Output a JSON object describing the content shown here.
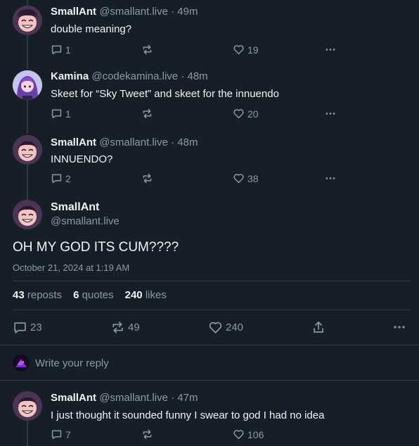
{
  "posts": [
    {
      "author_name": "SmallAnt",
      "author_handle": "@smallant.live",
      "separator": "·",
      "time": "49m",
      "text": "double meaning?",
      "reply_count": "1",
      "like_count": "19",
      "avatar": "smallant-avatar"
    },
    {
      "author_name": "Kamina",
      "author_handle": "@codekamina.live",
      "separator": "·",
      "time": "48m",
      "text": "Skeet for “Sky Tweet” and skeet for the innuendo",
      "reply_count": "1",
      "like_count": "20",
      "avatar": "kamina-avatar"
    },
    {
      "author_name": "SmallAnt",
      "author_handle": "@smallant.live",
      "separator": "·",
      "time": "48m",
      "text": "INNUENDO?",
      "reply_count": "2",
      "like_count": "38",
      "avatar": "smallant-avatar"
    }
  ],
  "main_post": {
    "author_name": "SmallAnt",
    "author_handle": "@smallant.live",
    "text": "OH MY GOD ITS CUM????",
    "date": "October 21, 2024 at 1:19 AM",
    "reposts_count": "43",
    "reposts_label": "reposts",
    "quotes_count": "6",
    "quotes_label": "quotes",
    "likes_count": "240",
    "likes_label": "likes",
    "reply_count": "23",
    "repost_count": "49",
    "like_count": "240"
  },
  "reply_composer": {
    "placeholder": "Write your reply"
  },
  "replies": [
    {
      "author_name": "SmallAnt",
      "author_handle": "@smallant.live",
      "separator": "·",
      "time": "47m",
      "text": "I just thought it sounded funny I swear to god I had no idea",
      "reply_count": "7",
      "like_count": "106"
    }
  ],
  "colors": {
    "background": "#161e27",
    "text": "#f1f3f5",
    "muted": "#8c9aa8",
    "divider": "#2e3a47"
  }
}
